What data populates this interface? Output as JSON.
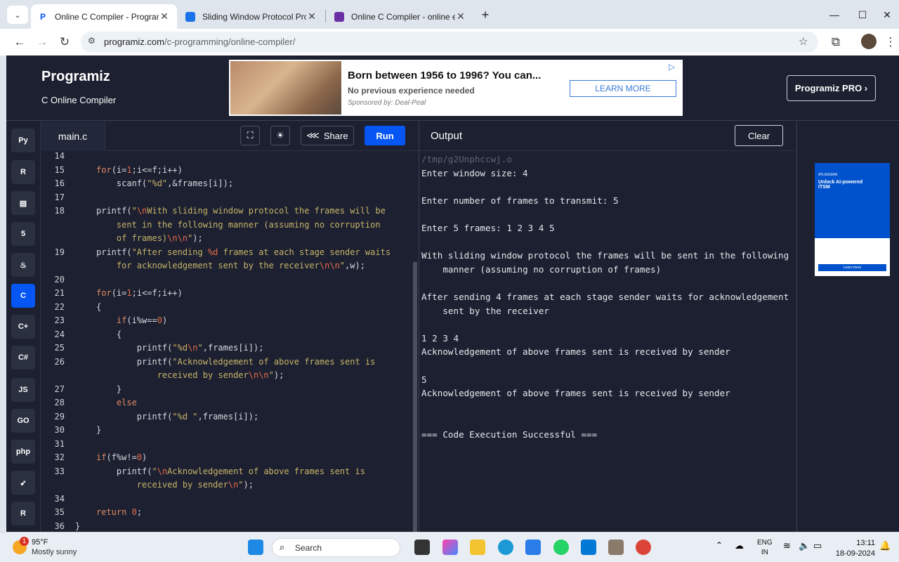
{
  "browser": {
    "tabs": [
      {
        "title": "Online C Compiler - Programiz",
        "active": true
      },
      {
        "title": "Sliding Window Protocol Progr...",
        "active": false
      },
      {
        "title": "Online C Compiler - online edi...",
        "active": false
      }
    ],
    "new_tab": "+",
    "url_host": "programiz.com",
    "url_path": "/c-programming/online-compiler/"
  },
  "header": {
    "logo": "Programiz",
    "subtitle": "C Online Compiler",
    "pro_button": "Programiz PRO ›"
  },
  "ad": {
    "title": "Born between 1956 to 1996? You can...",
    "subtitle": "No previous experience needed",
    "sponsor": "Sponsored by: Deal-Peal",
    "button": "LEARN MORE"
  },
  "sidebar": {
    "langs": [
      "py",
      "R",
      "SQL",
      "5",
      "java",
      "C",
      "C++",
      "C#",
      "JS",
      "GO",
      "php",
      "swift",
      "rust"
    ]
  },
  "editor": {
    "filename": "main.c",
    "share": "Share",
    "run": "Run"
  },
  "output": {
    "title": "Output",
    "clear": "Clear",
    "path": "/tmp/g2Unphccwj.o",
    "lines": [
      "Enter window size: 4",
      "",
      "Enter number of frames to transmit: 5",
      "",
      "Enter 5 frames: 1 2 3 4 5",
      "",
      "With sliding window protocol the frames will be sent in the following",
      "    manner (assuming no corruption of frames)",
      "",
      "After sending 4 frames at each stage sender waits for acknowledgement",
      "    sent by the receiver",
      "",
      "1 2 3 4",
      "Acknowledgement of above frames sent is received by sender",
      "",
      "5",
      "Acknowledgement of above frames sent is received by sender",
      "",
      "",
      "=== Code Execution Successful ==="
    ]
  },
  "right_ad": {
    "brand": "ATLASSIAN",
    "headline": "Unlock AI-powered ITSM",
    "button": "Learn more"
  },
  "taskbar": {
    "temp": "95°F",
    "weather": "Mostly sunny",
    "badge": "1",
    "search": "Search",
    "lang_top": "ENG",
    "lang_bottom": "IN",
    "time": "13:11",
    "date": "18-09-2024"
  }
}
